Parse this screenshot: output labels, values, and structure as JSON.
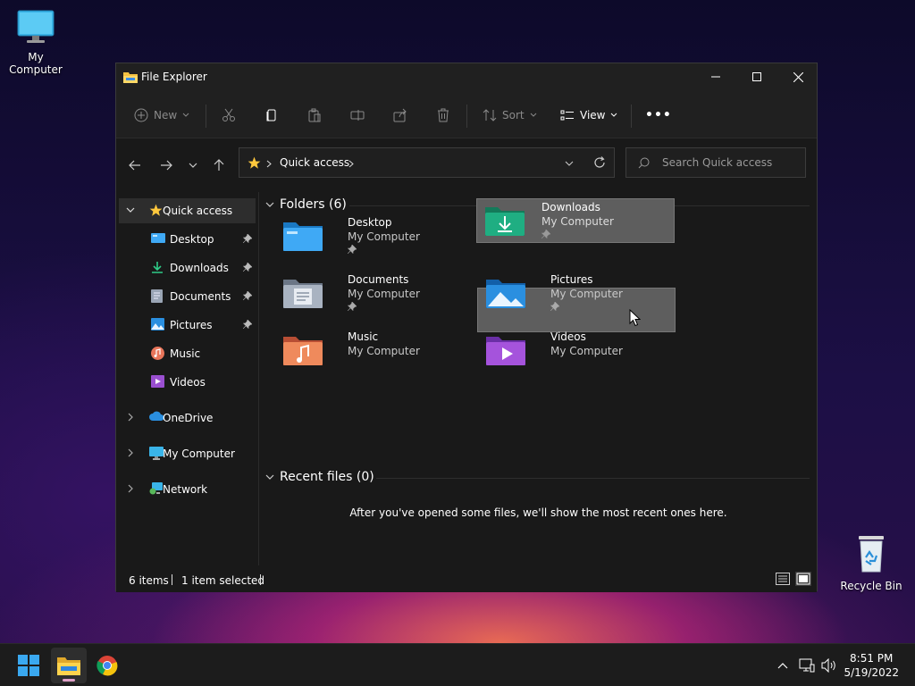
{
  "desktop": {
    "icons": [
      {
        "label": "My Computer"
      },
      {
        "label": "Recycle Bin"
      }
    ]
  },
  "window": {
    "title": "File Explorer",
    "controls": {
      "minimize": "—",
      "maximize": "☐",
      "close": "✕"
    }
  },
  "toolbar": {
    "new_label": "New",
    "sort_label": "Sort",
    "view_label": "View",
    "more_label": "•••"
  },
  "address": {
    "location": "Quick access",
    "search_placeholder": "Search Quick access"
  },
  "sidebar": {
    "quick_access": "Quick access",
    "pinned": [
      {
        "label": "Desktop"
      },
      {
        "label": "Downloads"
      },
      {
        "label": "Documents"
      },
      {
        "label": "Pictures"
      },
      {
        "label": "Music"
      },
      {
        "label": "Videos"
      }
    ],
    "onedrive": "OneDrive",
    "my_computer": "My Computer",
    "network": "Network"
  },
  "content": {
    "folders_header": "Folders (6)",
    "folders": [
      {
        "name": "Desktop",
        "location": "My Computer",
        "pinned": true
      },
      {
        "name": "Downloads",
        "location": "My Computer",
        "pinned": true
      },
      {
        "name": "Documents",
        "location": "My Computer",
        "pinned": true
      },
      {
        "name": "Pictures",
        "location": "My Computer",
        "pinned": true
      },
      {
        "name": "Music",
        "location": "My Computer",
        "pinned": false
      },
      {
        "name": "Videos",
        "location": "My Computer",
        "pinned": false
      }
    ],
    "recent_header": "Recent files (0)",
    "recent_empty": "After you've opened some files, we'll show the most recent ones here."
  },
  "status": {
    "items": "6 items",
    "selected": "1 item selected"
  },
  "taskbar": {
    "time": "8:51 PM",
    "date": "5/19/2022"
  },
  "colors": {
    "accent": "#ffc83d",
    "folder_blue": "#3fa9f5",
    "folder_green": "#1fae82",
    "selected_bg": "#5e5e5e"
  }
}
